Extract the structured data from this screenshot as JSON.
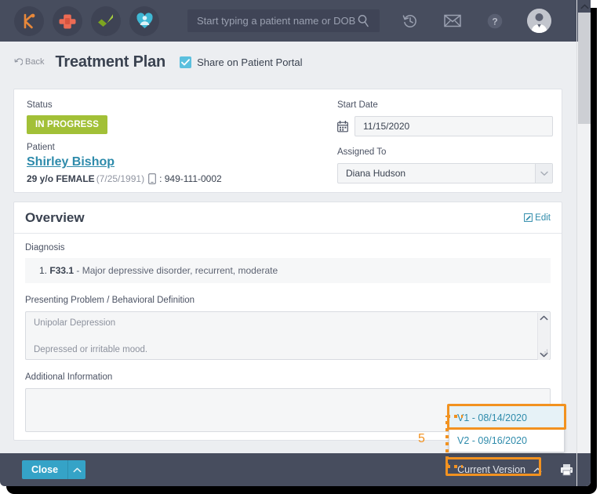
{
  "navbar": {
    "apps": [
      {
        "name": "kareo-logo-icon",
        "glyph": "K",
        "color": "#e8883a"
      },
      {
        "name": "clinical-cross-icon",
        "glyph": "✚",
        "color": "#ec6b54"
      },
      {
        "name": "billing-check-icon",
        "glyph": "✔",
        "color": "#9bc53d"
      },
      {
        "name": "patient-heart-icon",
        "glyph": "♥",
        "color": "#3fb8d4"
      }
    ],
    "search": {
      "name": "patient-search-input",
      "value": "",
      "placeholder": "Start typing a patient name or DOB"
    },
    "right_icons": [
      {
        "name": "history-icon"
      },
      {
        "name": "mail-icon"
      },
      {
        "name": "help-icon"
      },
      {
        "name": "user-avatar-icon"
      }
    ]
  },
  "header": {
    "back_label": "Back",
    "title": "Treatment Plan",
    "share_label": "Share on Patient Portal",
    "share_checked": true
  },
  "summary": {
    "status_label": "Status",
    "status_value": "IN PROGRESS",
    "patient_label": "Patient",
    "patient_name": "Shirley Bishop",
    "patient_age_sex": "29 y/o FEMALE",
    "patient_dob": "(7/25/1991)",
    "patient_phone": ": 949-111-0002",
    "start_date_label": "Start Date",
    "start_date_value": "11/15/2020",
    "assigned_label": "Assigned To",
    "assigned_value": "Diana Hudson"
  },
  "overview": {
    "title": "Overview",
    "edit_label": "Edit",
    "diagnosis_label": "Diagnosis",
    "diagnosis_number": "1.",
    "diagnosis_code": "F33.1",
    "diagnosis_text": "- Major depressive disorder, recurrent, moderate",
    "presenting_label": "Presenting Problem / Behavioral Definition",
    "presenting_line1": "Unipolar Depression",
    "presenting_line2": "Depressed or irritable mood.",
    "additional_label": "Additional Information",
    "additional_value": ""
  },
  "footer": {
    "close_label": "Close",
    "version_button_label": "Current Version",
    "print_icon": "printer-icon"
  },
  "version_menu": {
    "items": [
      {
        "label": "V1 - 08/14/2020",
        "selected": true
      },
      {
        "label": "V2 - 09/16/2020",
        "selected": false
      }
    ]
  },
  "annotation": {
    "step_number": "5",
    "color": "#f29220"
  }
}
